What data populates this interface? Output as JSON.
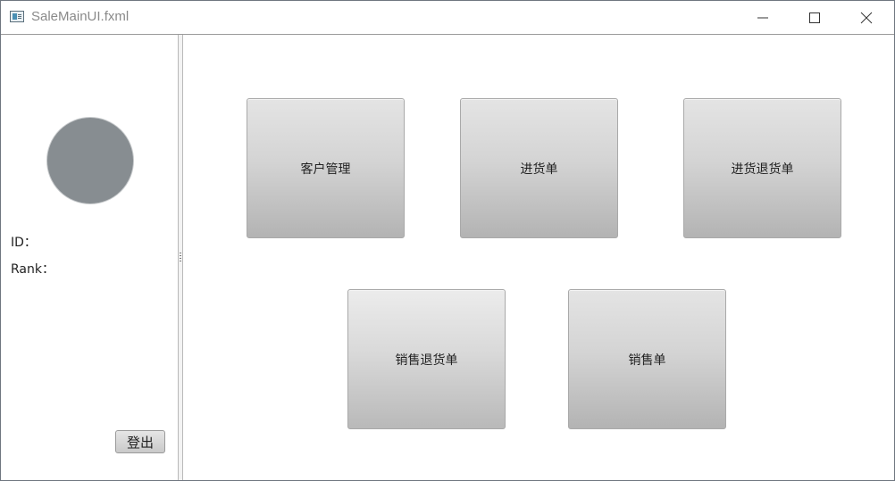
{
  "window": {
    "title": "SaleMainUI.fxml",
    "controls": {
      "minimize_icon": "minimize-icon",
      "maximize_icon": "maximize-icon",
      "close_icon": "close-icon"
    }
  },
  "sidebar": {
    "avatar_color": "#878d91",
    "id_label": "ID：",
    "rank_label": "Rank：",
    "logout_label": "登出"
  },
  "main": {
    "buttons": [
      {
        "label": "客户管理"
      },
      {
        "label": "进货单"
      },
      {
        "label": "进货退货单"
      },
      {
        "label": "销售退货单"
      },
      {
        "label": "销售单"
      }
    ]
  }
}
